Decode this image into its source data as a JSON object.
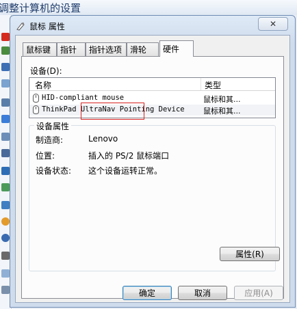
{
  "background_window": {
    "title": "调整计算机的设置"
  },
  "dialog": {
    "title": "鼠标 属性",
    "close_label": "✕",
    "tabs": [
      {
        "label": "鼠标键",
        "active": false
      },
      {
        "label": "指针",
        "active": false
      },
      {
        "label": "指针选项",
        "active": false
      },
      {
        "label": "滑轮",
        "active": false
      },
      {
        "label": "硬件",
        "active": true
      }
    ]
  },
  "hardware": {
    "devices_label": "设备(D):",
    "columns": {
      "name": "名称",
      "type": "类型"
    },
    "devices": [
      {
        "name": "HID-compliant mouse",
        "type": "鼠标和其..."
      },
      {
        "name": "ThinkPad UltraNav Pointing Device",
        "type": "鼠标和其..."
      }
    ],
    "properties": {
      "group_title": "设备属性",
      "manufacturer_label": "制造商:",
      "manufacturer_value": "Lenovo",
      "location_label": "位置:",
      "location_value": "插入的 PS/2 鼠标端口",
      "status_label": "设备状态:",
      "status_value": "这个设备运转正常。"
    },
    "properties_button": "属性(R)"
  },
  "footer": {
    "ok": "确定",
    "cancel": "取消",
    "apply": "应用(A)"
  },
  "colors": {
    "annotation_box": "#d9201f",
    "title_bar": "#dfeaf7"
  }
}
